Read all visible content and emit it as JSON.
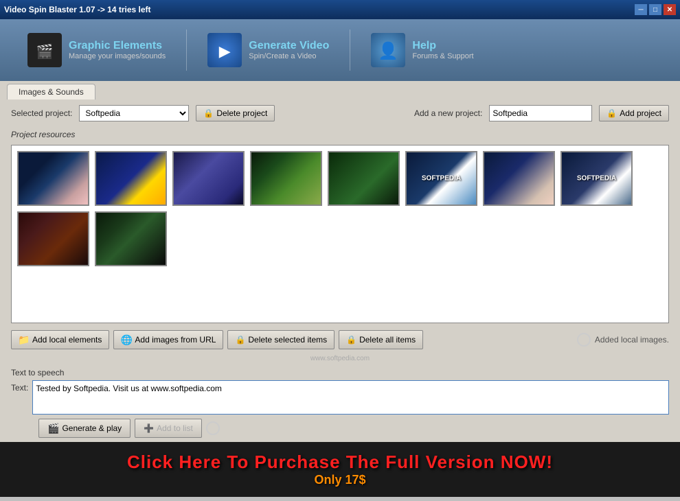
{
  "titleBar": {
    "title": "Video Spin Blaster 1.07 -> 14 tries left",
    "minimize": "─",
    "maximize": "□",
    "close": "✕"
  },
  "nav": {
    "items": [
      {
        "id": "graphic-elements",
        "icon": "film",
        "title": "Graphic Elements",
        "subtitle": "Manage your images/sounds"
      },
      {
        "id": "generate-video",
        "icon": "play",
        "title": "Generate Video",
        "subtitle": "Spin/Create a Video"
      },
      {
        "id": "help",
        "icon": "help",
        "title": "Help",
        "subtitle": "Forums & Support"
      }
    ]
  },
  "tabs": {
    "active": "Images & Sounds",
    "list": [
      "Images & Sounds"
    ]
  },
  "project": {
    "selectedLabel": "Selected project:",
    "selectedValue": "Softpedia",
    "deleteLabel": "Delete project",
    "newLabel": "Add a new project:",
    "newValue": "Softpedia",
    "addLabel": "Add project"
  },
  "resources": {
    "label": "Project resources",
    "thumbs": [
      {
        "id": 1,
        "class": "thumb-1",
        "text": ""
      },
      {
        "id": 2,
        "class": "thumb-2",
        "text": ""
      },
      {
        "id": 3,
        "class": "thumb-3",
        "text": ""
      },
      {
        "id": 4,
        "class": "thumb-4",
        "text": ""
      },
      {
        "id": 5,
        "class": "thumb-5",
        "text": ""
      },
      {
        "id": 6,
        "class": "thumb-6",
        "text": "SOFTPEDIA"
      },
      {
        "id": 7,
        "class": "thumb-7",
        "text": ""
      },
      {
        "id": 8,
        "class": "thumb-8",
        "text": "SOFTPEDIA"
      },
      {
        "id": 9,
        "class": "thumb-9",
        "text": ""
      },
      {
        "id": 10,
        "class": "thumb-10",
        "text": ""
      }
    ]
  },
  "toolbar": {
    "addLocalLabel": "Add local elements",
    "addUrlLabel": "Add images from URL",
    "deleteSelectedLabel": "Delete selected items",
    "deleteAllLabel": "Delete all items",
    "statusText": "Added local images."
  },
  "tts": {
    "sectionLabel": "Text to speech",
    "textLabel": "Text:",
    "textValue": "Tested by Softpedia. Visit us at www.softpedia.com",
    "generateLabel": "Generate & play",
    "addToListLabel": "Add to list"
  },
  "watermark": {
    "text": "www.softpedia.com"
  },
  "banner": {
    "mainText": "Click Here To Purchase The Full Version NOW!",
    "subText": "Only 17$"
  }
}
